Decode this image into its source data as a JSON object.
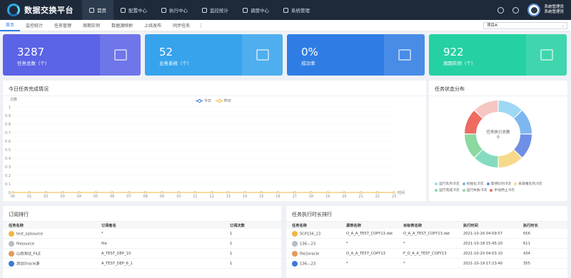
{
  "app": {
    "title": "数据交换平台"
  },
  "topnav": [
    {
      "label": "首页",
      "icon": "home-icon",
      "active": true
    },
    {
      "label": "配置中心",
      "icon": "grid-icon",
      "active": false
    },
    {
      "label": "执行中心",
      "icon": "rocket-icon",
      "active": false
    },
    {
      "label": "监控统计",
      "icon": "monitor-icon",
      "active": false
    },
    {
      "label": "调度中心",
      "icon": "clock-icon",
      "active": false
    },
    {
      "label": "系统管理",
      "icon": "flag-icon",
      "active": false
    }
  ],
  "user": {
    "role": "系统管理员",
    "name": "系统管理员"
  },
  "tabs": [
    {
      "label": "首页",
      "active": true
    },
    {
      "label": "监控统计",
      "active": false
    },
    {
      "label": "任务管理",
      "active": false
    },
    {
      "label": "周期实例",
      "active": false
    },
    {
      "label": "数据源映射",
      "active": false
    },
    {
      "label": "上线发布",
      "active": false
    },
    {
      "label": "同步任务",
      "active": false
    }
  ],
  "project_select": {
    "value": "项目A"
  },
  "cards": [
    {
      "value": "3287",
      "label": "任务总数（个）",
      "color": "#5b63e6",
      "icon": "document-icon"
    },
    {
      "value": "52",
      "label": "业务系统（个）",
      "color": "#37a3ec",
      "icon": "screen-icon"
    },
    {
      "value": "0%",
      "label": "成功率",
      "color": "#2f7de4",
      "icon": "check-calendar-icon"
    },
    {
      "value": "922",
      "label": "周期实例（个）",
      "color": "#25d1a3",
      "icon": "layers-icon"
    }
  ],
  "today_panel": {
    "title": "今日任务完成情况"
  },
  "status_panel": {
    "title": "任务状态分布",
    "center_label": "任务执行总数",
    "center_value": "0"
  },
  "chart_data": {
    "type": "line",
    "title": "",
    "ylabel": "次数",
    "xlabel": "时间",
    "x": [
      "00",
      "01",
      "02",
      "03",
      "04",
      "05",
      "06",
      "07",
      "08",
      "09",
      "10",
      "11",
      "12",
      "13",
      "14",
      "15",
      "16",
      "17",
      "18",
      "19",
      "20",
      "21",
      "22",
      "23"
    ],
    "ylim": [
      0,
      1
    ],
    "yticks": [
      "1",
      "0.9",
      "0.8",
      "0.7",
      "0.6",
      "0.5",
      "0.4",
      "0.3",
      "0.2",
      "0.1",
      "0"
    ],
    "series": [
      {
        "name": "今日",
        "color": "#3a6fd8",
        "values": [
          0,
          0,
          0,
          0,
          0,
          0,
          0,
          0,
          0,
          0,
          0,
          0,
          0,
          0,
          0,
          0,
          0,
          0,
          0,
          0,
          0,
          0,
          0,
          0
        ]
      },
      {
        "name": "昨日",
        "color": "#f2b544",
        "values": [
          0,
          0,
          0,
          0,
          0,
          0,
          0,
          0,
          0,
          0,
          0,
          0,
          0,
          0,
          0,
          0,
          0,
          0,
          0,
          0,
          0,
          0,
          0,
          0
        ]
      }
    ]
  },
  "pie": {
    "segments": [
      {
        "label": "运行队列:0次",
        "color": "#9ed8f5",
        "value": 1
      },
      {
        "label": "初始化:0次",
        "color": "#7eb7ef",
        "value": 1
      },
      {
        "label": "等待队列:0次",
        "color": "#6f8fe6",
        "value": 1
      },
      {
        "label": "未就绪队列:0次",
        "color": "#f7d98a",
        "value": 1
      },
      {
        "label": "运行完成:0次",
        "color": "#84dbc0",
        "value": 1
      },
      {
        "label": "运行失败:0次",
        "color": "#8ad99f",
        "value": 1
      },
      {
        "label": "手动停止:0次",
        "color": "#ee6b61",
        "value": 1
      },
      {
        "label": "",
        "color": "#f6c6c3",
        "value": 1
      }
    ]
  },
  "subscribe_panel": {
    "title": "订阅排行",
    "columns": [
      "任务名称",
      "订阅者名",
      "订阅次数"
    ],
    "rows": [
      {
        "name": "test_sqlsource",
        "sub": "*",
        "count": "1",
        "medal": "#f2b544"
      },
      {
        "name": "filesource",
        "sub": "file",
        "count": "1",
        "medal": "#b5bcc6"
      },
      {
        "name": "山西测试_FILE",
        "sub": "A_TEST_DEP_10",
        "count": "1",
        "medal": "#e39a5a"
      },
      {
        "name": "测试Oracle源",
        "sub": "A_TEST_DEP_6_1",
        "count": "1",
        "medal": "#3a7bd5"
      }
    ]
  },
  "duration_panel": {
    "title": "任务执行时长排行",
    "columns": [
      "任务名称",
      "源表名称",
      "目标表名称",
      "执行时间",
      "执行时长"
    ],
    "rows": [
      {
        "name": "SCP156_23",
        "src": "O_A_A_TEST_COPY13.dat",
        "dst": "O_A_A_TEST_COPY13.dat",
        "time": "2021-10-16 04:09:57",
        "dur": "656",
        "medal": "#f2b544"
      },
      {
        "name": "136---23",
        "src": "*",
        "dst": "*",
        "time": "2021-10-18 15:45:20",
        "dur": "611",
        "medal": "#b5bcc6"
      },
      {
        "name": "file2oracle",
        "src": "O_A_A_TEST_COPY13",
        "dst": "F_O_A_A_TEST_COPY13",
        "time": "2021-10-20 04:03:10",
        "dur": "434",
        "medal": "#e39a5a"
      },
      {
        "name": "136---23",
        "src": "*",
        "dst": "*",
        "time": "2021-10-19 17:23:40",
        "dur": "355",
        "medal": "#3a7bd5"
      }
    ]
  }
}
